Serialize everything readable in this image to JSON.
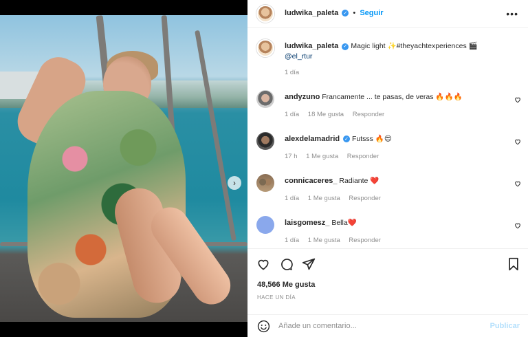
{
  "post": {
    "username": "ludwika_paleta",
    "follow_label": "Seguir",
    "more_label": "•••",
    "caption_text": "Magic light ✨#theyachtexperiences 🎬",
    "caption_mention": "@el_rtur",
    "caption_time": "1 día",
    "image_dots": 4,
    "active_dot": 1
  },
  "comments": [
    {
      "username": "andyzuno",
      "text": "Francamente ... te pasas, de veras 🔥🔥🔥",
      "time": "1 día",
      "likes": "18 Me gusta",
      "reply": "Responder",
      "verified": false
    },
    {
      "username": "alexdelamadrid",
      "text": "Futsss 🔥😍",
      "time": "17 h",
      "likes": "1 Me gusta",
      "reply": "Responder",
      "verified": true
    },
    {
      "username": "connicaceres_",
      "text": "Radiante ❤️",
      "time": "1 día",
      "likes": "1 Me gusta",
      "reply": "Responder",
      "verified": false
    },
    {
      "username": "laisgomesz_",
      "text": "Bella❤️",
      "time": "1 día",
      "likes": "1 Me gusta",
      "reply": "Responder",
      "verified": false
    }
  ],
  "actions": {
    "likes_count": "48,566 Me gusta",
    "posted_ago": "HACE UN DÍA"
  },
  "add_comment": {
    "placeholder": "Añade un comentario...",
    "publish_label": "Publicar"
  },
  "colors": {
    "accent": "#0095f6",
    "verified": "#3897f0",
    "publish_disabled": "#b2dffc",
    "meta_text": "#8e8e8e"
  }
}
